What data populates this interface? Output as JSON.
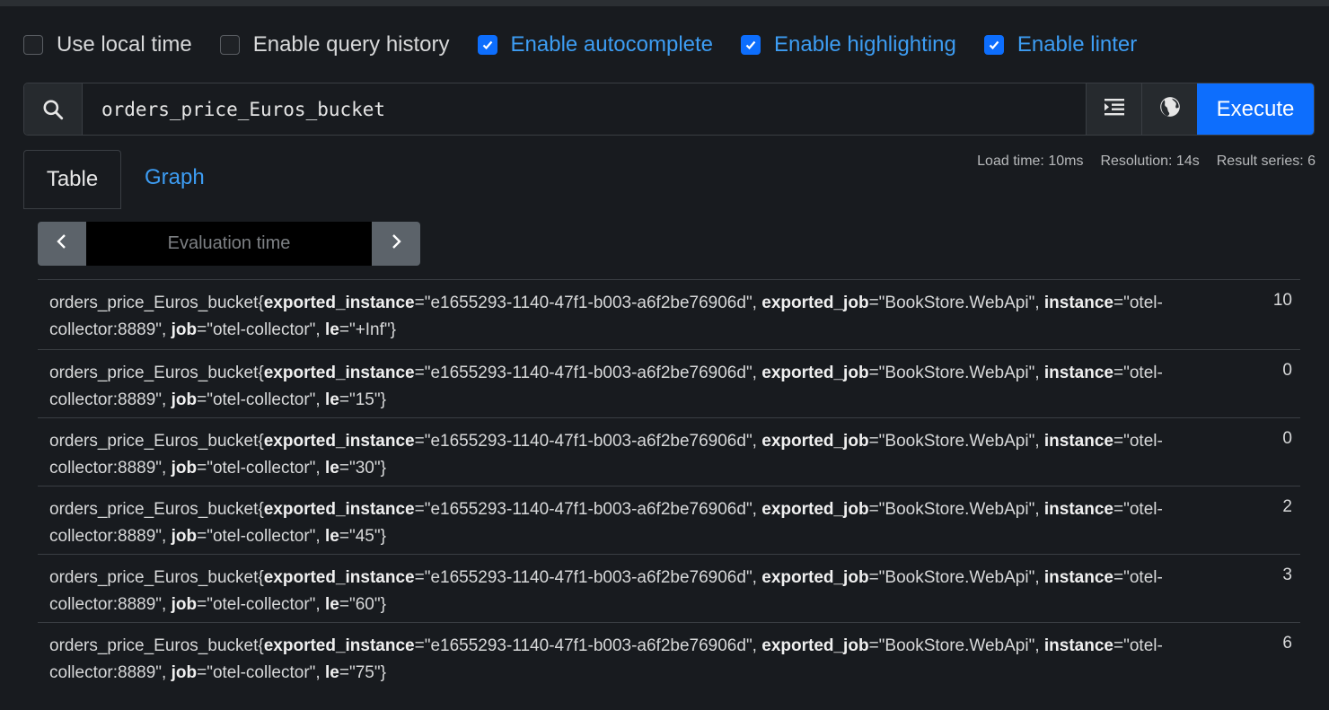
{
  "options": [
    {
      "label": "Use local time",
      "checked": false
    },
    {
      "label": "Enable query history",
      "checked": false
    },
    {
      "label": "Enable autocomplete",
      "checked": true
    },
    {
      "label": "Enable highlighting",
      "checked": true
    },
    {
      "label": "Enable linter",
      "checked": true
    }
  ],
  "query": {
    "value": "orders_price_Euros_bucket",
    "execute_label": "Execute"
  },
  "tabs": {
    "table": "Table",
    "graph": "Graph"
  },
  "stats": {
    "load_time": "Load time: 10ms",
    "resolution": "Resolution: 14s",
    "result_series": "Result series: 6"
  },
  "eval": {
    "placeholder": "Evaluation time"
  },
  "results": [
    {
      "metric": "orders_price_Euros_bucket",
      "exported_instance": "e1655293-1140-47f1-b003-a6f2be76906d",
      "exported_job": "BookStore.WebApi",
      "instance": "otel-collector:8889",
      "job": "otel-collector",
      "le": "+Inf",
      "value": "10"
    },
    {
      "metric": "orders_price_Euros_bucket",
      "exported_instance": "e1655293-1140-47f1-b003-a6f2be76906d",
      "exported_job": "BookStore.WebApi",
      "instance": "otel-collector:8889",
      "job": "otel-collector",
      "le": "15",
      "value": "0"
    },
    {
      "metric": "orders_price_Euros_bucket",
      "exported_instance": "e1655293-1140-47f1-b003-a6f2be76906d",
      "exported_job": "BookStore.WebApi",
      "instance": "otel-collector:8889",
      "job": "otel-collector",
      "le": "30",
      "value": "0"
    },
    {
      "metric": "orders_price_Euros_bucket",
      "exported_instance": "e1655293-1140-47f1-b003-a6f2be76906d",
      "exported_job": "BookStore.WebApi",
      "instance": "otel-collector:8889",
      "job": "otel-collector",
      "le": "45",
      "value": "2"
    },
    {
      "metric": "orders_price_Euros_bucket",
      "exported_instance": "e1655293-1140-47f1-b003-a6f2be76906d",
      "exported_job": "BookStore.WebApi",
      "instance": "otel-collector:8889",
      "job": "otel-collector",
      "le": "60",
      "value": "3"
    },
    {
      "metric": "orders_price_Euros_bucket",
      "exported_instance": "e1655293-1140-47f1-b003-a6f2be76906d",
      "exported_job": "BookStore.WebApi",
      "instance": "otel-collector:8889",
      "job": "otel-collector",
      "le": "75",
      "value": "6"
    }
  ],
  "colors": {
    "accent": "#0d6efd",
    "link": "#3d9df3",
    "background": "#181b1f"
  }
}
